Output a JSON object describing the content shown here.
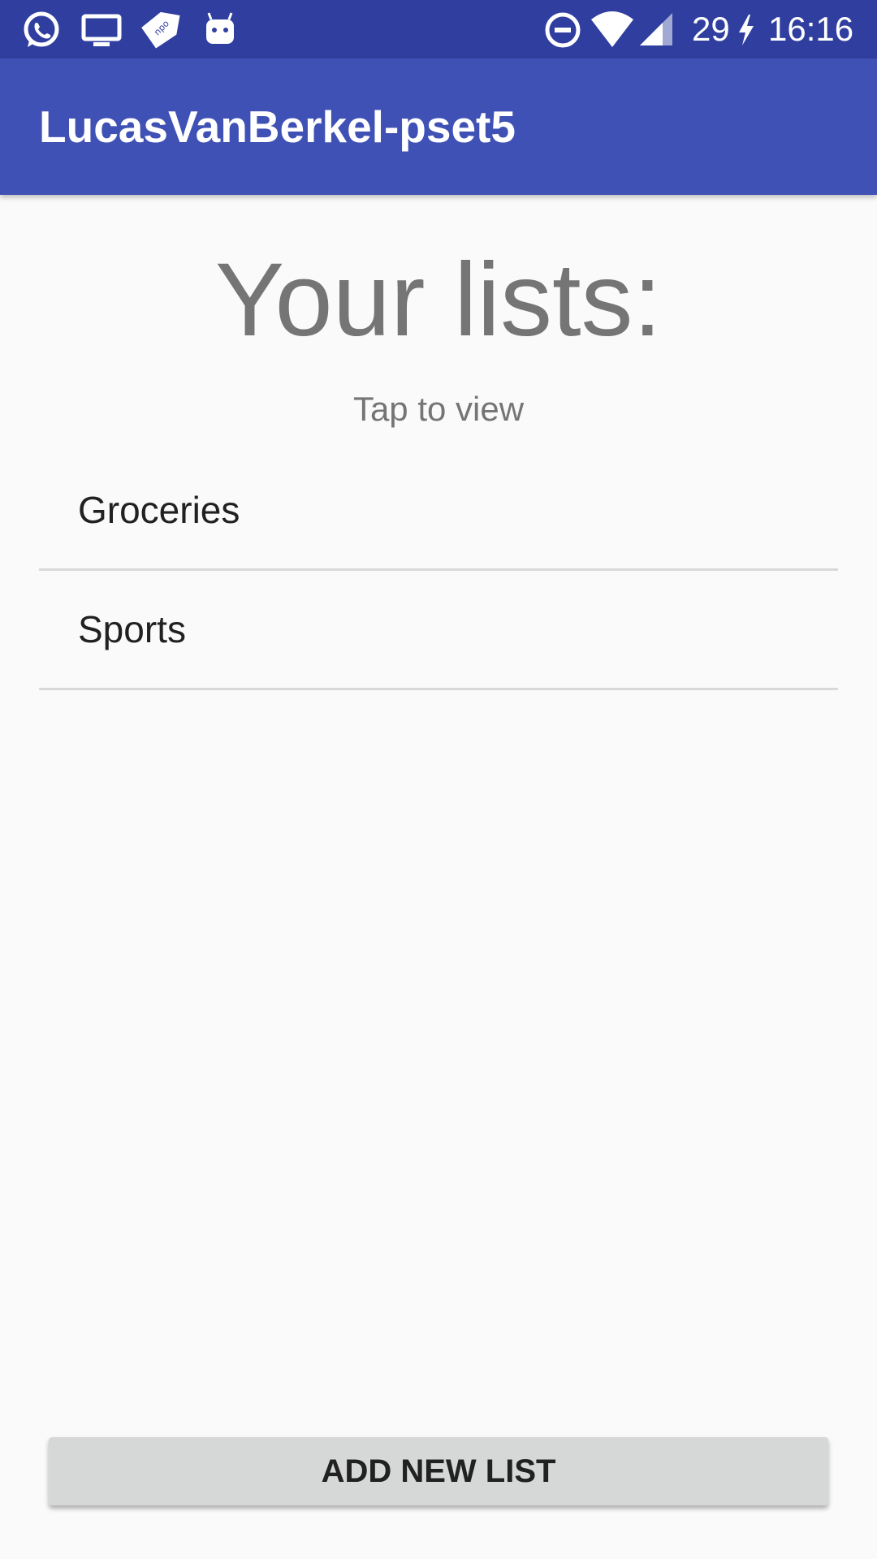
{
  "status_bar": {
    "left_icons": [
      "whatsapp-icon",
      "tv-icon",
      "npo-tag-icon",
      "android-bot-icon"
    ],
    "right_icons": [
      "do-not-disturb-icon",
      "wifi-icon",
      "cellular-signal-icon",
      "charging-bolt-icon"
    ],
    "battery_level": "29",
    "time": "16:16",
    "color": "#303f9f"
  },
  "app_bar": {
    "title": "LucasVanBerkel-pset5",
    "color": "#3f51b5"
  },
  "main": {
    "heading": "Your lists:",
    "subheading": "Tap to view",
    "lists": [
      {
        "label": "Groceries"
      },
      {
        "label": "Sports"
      }
    ],
    "add_button_label": "ADD NEW LIST"
  }
}
